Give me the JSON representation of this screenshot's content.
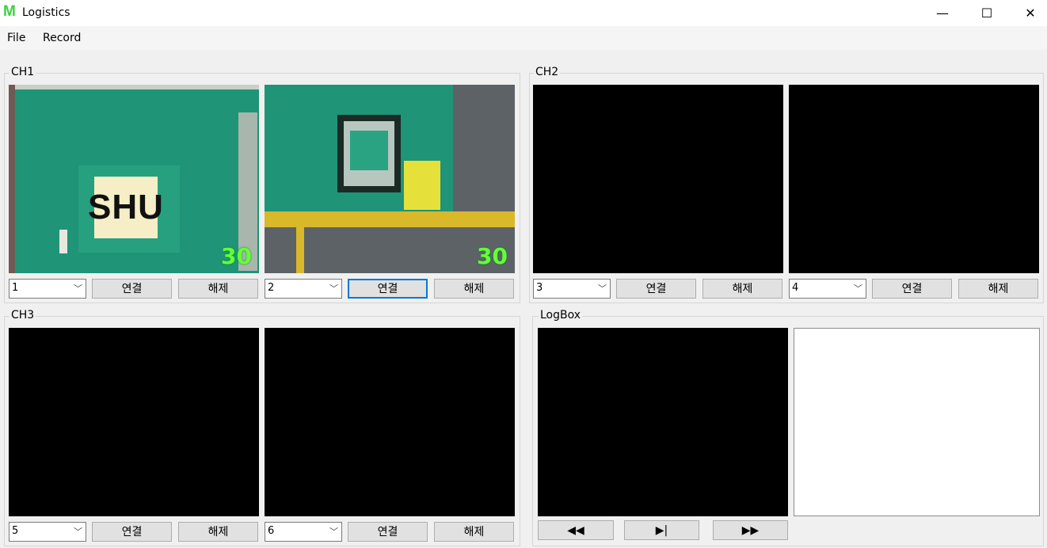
{
  "window": {
    "logo": "M",
    "title": "Logistics",
    "minimize_glyph": "—",
    "maximize_glyph": "☐",
    "close_glyph": "✕"
  },
  "menu": [
    "File",
    "Record"
  ],
  "groups": {
    "ch1": "CH1",
    "ch2": "CH2",
    "ch3": "CH3",
    "logbox": "LogBox"
  },
  "connect_label": "연결",
  "disconnect_label": "해제",
  "cameras": [
    {
      "select": "1",
      "fps": "30",
      "sign": "SHU"
    },
    {
      "select": "2",
      "fps": "30"
    },
    {
      "select": "3"
    },
    {
      "select": "4"
    },
    {
      "select": "5"
    },
    {
      "select": "6"
    }
  ],
  "playback": {
    "rewind": "◀◀",
    "step": "▶|",
    "fast_forward": "▶▶"
  },
  "colors": {
    "fps_overlay": "#66ff33",
    "focus_border": "#0078d7",
    "logo": "#3fd03f"
  }
}
